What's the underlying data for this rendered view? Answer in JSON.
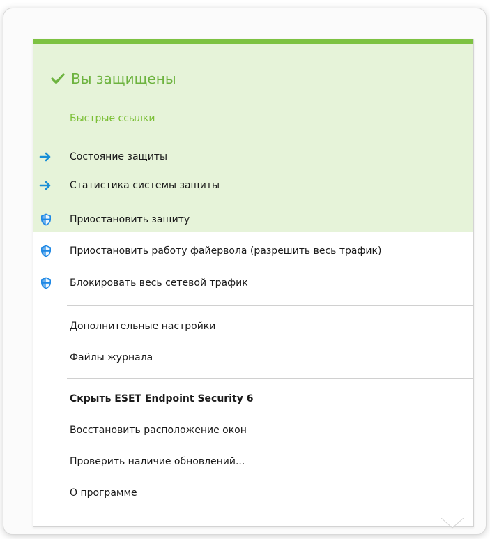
{
  "colors": {
    "accent_green": "#7dc242",
    "status_green": "#6db33f",
    "highlight_bg": "#e6f3d9",
    "arrow_blue": "#1a8fd6",
    "shield_blue": "#1e88e5"
  },
  "status": {
    "text": "Вы защищены",
    "icon": "checkmark-icon"
  },
  "quick_links": {
    "title": "Быстрые ссылки",
    "items": [
      {
        "label": "Состояние защиты",
        "icon": "arrow-right-icon"
      },
      {
        "label": "Статистика системы защиты",
        "icon": "arrow-right-icon"
      }
    ]
  },
  "protection_actions": [
    {
      "label": "Приостановить защиту",
      "icon": "shield-icon"
    },
    {
      "label": "Приостановить работу файервола (разрешить весь трафик)",
      "icon": "shield-icon"
    },
    {
      "label": "Блокировать весь сетевой трафик",
      "icon": "shield-icon"
    }
  ],
  "settings_items": [
    {
      "label": "Дополнительные настройки"
    },
    {
      "label": "Файлы журнала"
    }
  ],
  "app_items": [
    {
      "label": "Скрыть ESET Endpoint Security 6",
      "bold": true
    },
    {
      "label": "Восстановить расположение окон"
    },
    {
      "label": "Проверить наличие обновлений..."
    },
    {
      "label": "О программе"
    }
  ]
}
